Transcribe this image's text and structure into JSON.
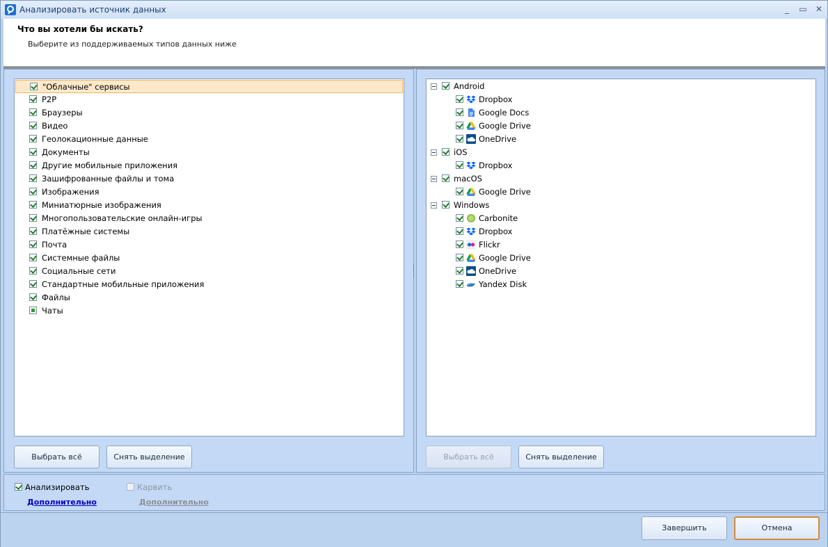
{
  "window": {
    "title": "Анализировать источник данных",
    "minimize_glyph": "_",
    "maximize_glyph": "▭",
    "close_glyph": "✕"
  },
  "header": {
    "question": "Что вы хотели бы искать?",
    "subtitle": "Выберите из поддерживаемых типов данных ниже"
  },
  "left_list": {
    "items": [
      {
        "label": "\"Облачные\" сервисы",
        "state": "checked",
        "selected": true
      },
      {
        "label": "P2P",
        "state": "checked"
      },
      {
        "label": "Браузеры",
        "state": "checked"
      },
      {
        "label": "Видео",
        "state": "checked"
      },
      {
        "label": "Геолокационные данные",
        "state": "checked"
      },
      {
        "label": "Документы",
        "state": "checked"
      },
      {
        "label": "Другие мобильные приложения",
        "state": "checked"
      },
      {
        "label": "Зашифрованные файлы и тома",
        "state": "checked"
      },
      {
        "label": "Изображения",
        "state": "checked"
      },
      {
        "label": "Миниатюрные изображения",
        "state": "checked"
      },
      {
        "label": "Многопользовательские онлайн-игры",
        "state": "checked"
      },
      {
        "label": "Платёжные системы",
        "state": "checked"
      },
      {
        "label": "Почта",
        "state": "checked"
      },
      {
        "label": "Системные файлы",
        "state": "checked"
      },
      {
        "label": "Социальные сети",
        "state": "checked"
      },
      {
        "label": "Стандартные мобильные приложения",
        "state": "checked"
      },
      {
        "label": "Файлы",
        "state": "checked"
      },
      {
        "label": "Чаты",
        "state": "indeterminate"
      }
    ],
    "select_all_label": "Выбрать всё",
    "deselect_label": "Снять выделение"
  },
  "right_tree": {
    "groups": [
      {
        "label": "Android",
        "children": [
          {
            "label": "Dropbox",
            "icon": "dropbox-icon"
          },
          {
            "label": "Google Docs",
            "icon": "google-docs-icon"
          },
          {
            "label": "Google Drive",
            "icon": "google-drive-icon"
          },
          {
            "label": "OneDrive",
            "icon": "onedrive-icon"
          }
        ]
      },
      {
        "label": "iOS",
        "children": [
          {
            "label": "Dropbox",
            "icon": "dropbox-icon"
          }
        ]
      },
      {
        "label": "macOS",
        "children": [
          {
            "label": "Google Drive",
            "icon": "google-drive-icon"
          }
        ]
      },
      {
        "label": "Windows",
        "children": [
          {
            "label": "Carbonite",
            "icon": "carbonite-icon"
          },
          {
            "label": "Dropbox",
            "icon": "dropbox-icon"
          },
          {
            "label": "Flickr",
            "icon": "flickr-icon"
          },
          {
            "label": "Google Drive",
            "icon": "google-drive-icon"
          },
          {
            "label": "OneDrive",
            "icon": "onedrive-icon"
          },
          {
            "label": "Yandex Disk",
            "icon": "yandex-disk-icon"
          }
        ]
      }
    ],
    "select_all_label": "Выбрать всё",
    "deselect_label": "Снять выделение"
  },
  "options": {
    "analyze_label": "Анализировать",
    "analyze_checked": true,
    "analyze_more": "Дополнительно",
    "carve_label": "Карвить",
    "carve_checked": false,
    "carve_more": "Дополнительно"
  },
  "footer": {
    "finish_label": "Завершить",
    "cancel_label": "Отмена"
  },
  "colors": {
    "accent": "#1d6fd0",
    "link": "#0000c8",
    "selection": "#fde9c9",
    "check": "#1e7f1e"
  }
}
